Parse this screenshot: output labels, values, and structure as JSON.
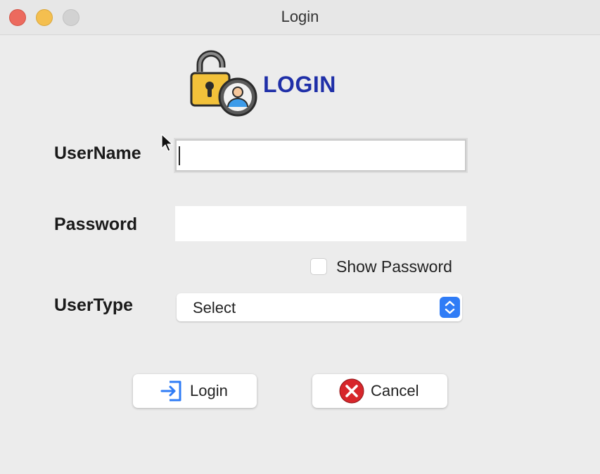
{
  "window": {
    "title": "Login"
  },
  "header": {
    "title": "LOGIN",
    "icon": "lock-user-icon"
  },
  "form": {
    "username": {
      "label": "UserName",
      "value": ""
    },
    "password": {
      "label": "Password",
      "value": ""
    },
    "show_password": {
      "label": "Show Password",
      "checked": false
    },
    "usertype": {
      "label": "UserType",
      "selected": "Select"
    }
  },
  "buttons": {
    "login": {
      "label": "Login",
      "icon": "sign-in-icon"
    },
    "cancel": {
      "label": "Cancel",
      "icon": "cancel-icon"
    }
  },
  "colors": {
    "header_text": "#1f2fa8",
    "select_arrow": "#2f7cf6",
    "cancel_icon": "#d7262b",
    "login_icon": "#2f7cf6"
  }
}
